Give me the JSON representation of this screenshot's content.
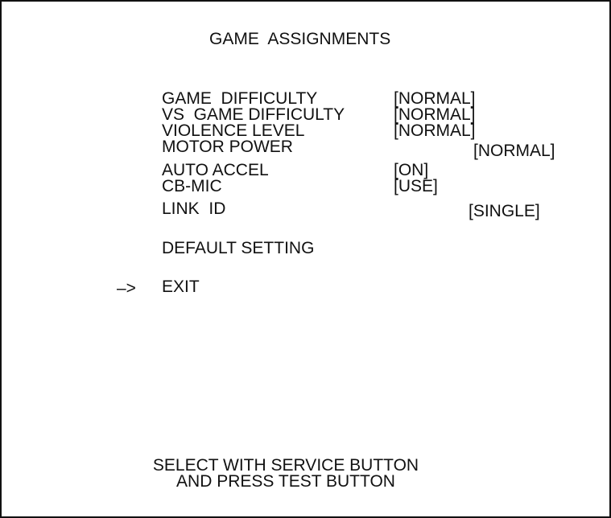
{
  "screen": {
    "title": "GAME  ASSIGNMENTS",
    "settings": [
      {
        "label": "GAME  DIFFICULTY",
        "value": "[NORMAL]"
      },
      {
        "label": "VS  GAME DIFFICULTY",
        "value": "[NORMAL]"
      },
      {
        "label": "VIOLENCE LEVEL",
        "value": "[NORMAL]"
      },
      {
        "label": "MOTOR POWER",
        "value": "[NORMAL]"
      },
      {
        "label": "AUTO ACCEL",
        "value": "[ON]"
      },
      {
        "label": "CB-MIC",
        "value": "[USE]"
      },
      {
        "label": "LINK  ID",
        "value": "[SINGLE]"
      }
    ],
    "default_setting": "DEFAULT SETTING",
    "exit": "EXIT",
    "cursor": "–>",
    "footer_line1": "SELECT WITH SERVICE BUTTON",
    "footer_line2": "AND PRESS TEST BUTTON"
  }
}
